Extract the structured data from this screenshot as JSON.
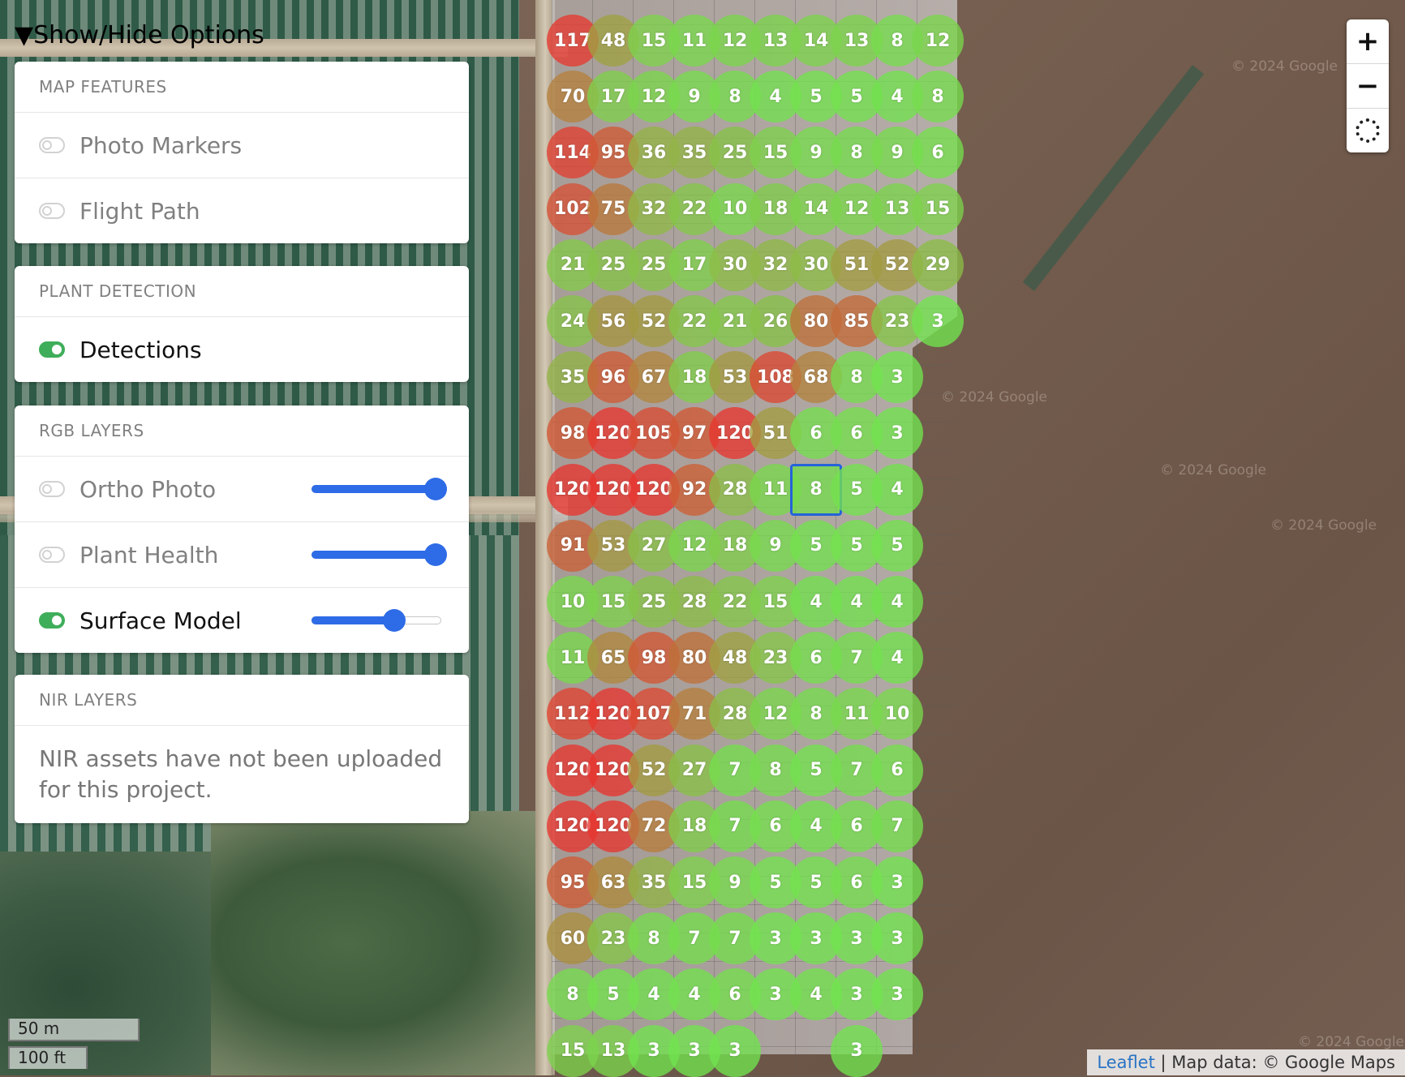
{
  "options_toggle": "▼Show/Hide Options",
  "panels": {
    "map_features": {
      "title": "MAP FEATURES",
      "items": [
        {
          "label": "Photo Markers",
          "enabled": false
        },
        {
          "label": "Flight Path",
          "enabled": false
        }
      ]
    },
    "plant_detection": {
      "title": "PLANT DETECTION",
      "items": [
        {
          "label": "Detections",
          "enabled": true
        }
      ]
    },
    "rgb_layers": {
      "title": "RGB LAYERS",
      "items": [
        {
          "label": "Ortho Photo",
          "enabled": false,
          "opacity": 1.0
        },
        {
          "label": "Plant Health",
          "enabled": false,
          "opacity": 1.0
        },
        {
          "label": "Surface Model",
          "enabled": true,
          "opacity": 0.65
        }
      ]
    },
    "nir_layers": {
      "title": "NIR LAYERS",
      "message": "NIR assets have not been uploaded for this project."
    }
  },
  "zoom": {
    "in_label": "+",
    "out_label": "−"
  },
  "scale": {
    "metric": "50 m",
    "imperial": "100 ft"
  },
  "attribution": {
    "leaflet": "Leaflet",
    "separator": " | ",
    "map_data": "Map data: © Google Maps"
  },
  "watermark": "© 2024 Google",
  "detection_counts": {
    "max_value": 120,
    "colors": {
      "low": "#6ee84f",
      "high": "#e8362f"
    },
    "selected": {
      "row": 8,
      "col": 6
    },
    "rows": [
      [
        117,
        48,
        15,
        11,
        12,
        13,
        14,
        13,
        8,
        12
      ],
      [
        70,
        17,
        12,
        9,
        8,
        4,
        5,
        5,
        4,
        8
      ],
      [
        114,
        95,
        36,
        35,
        25,
        15,
        9,
        8,
        9,
        6
      ],
      [
        102,
        75,
        32,
        22,
        10,
        18,
        14,
        12,
        13,
        15
      ],
      [
        21,
        25,
        25,
        17,
        30,
        32,
        30,
        51,
        52,
        29
      ],
      [
        24,
        56,
        52,
        22,
        21,
        26,
        80,
        85,
        23,
        3
      ],
      [
        35,
        96,
        67,
        18,
        53,
        108,
        68,
        8,
        3
      ],
      [
        98,
        120,
        105,
        97,
        120,
        51,
        6,
        6,
        3
      ],
      [
        120,
        120,
        120,
        92,
        28,
        11,
        8,
        5,
        4
      ],
      [
        91,
        53,
        27,
        12,
        18,
        9,
        5,
        5,
        5
      ],
      [
        10,
        15,
        25,
        28,
        22,
        15,
        4,
        4,
        4
      ],
      [
        11,
        65,
        98,
        80,
        48,
        23,
        6,
        7,
        4
      ],
      [
        112,
        120,
        107,
        71,
        28,
        12,
        8,
        11,
        10
      ],
      [
        120,
        120,
        52,
        27,
        7,
        8,
        5,
        7,
        6
      ],
      [
        120,
        120,
        72,
        18,
        7,
        6,
        4,
        6,
        7
      ],
      [
        95,
        63,
        35,
        15,
        9,
        5,
        5,
        6,
        3
      ],
      [
        60,
        23,
        8,
        7,
        7,
        3,
        3,
        3,
        3
      ],
      [
        8,
        5,
        4,
        4,
        6,
        3,
        4,
        3,
        3
      ],
      [
        15,
        13,
        3,
        3,
        3,
        null,
        null,
        3
      ]
    ]
  }
}
